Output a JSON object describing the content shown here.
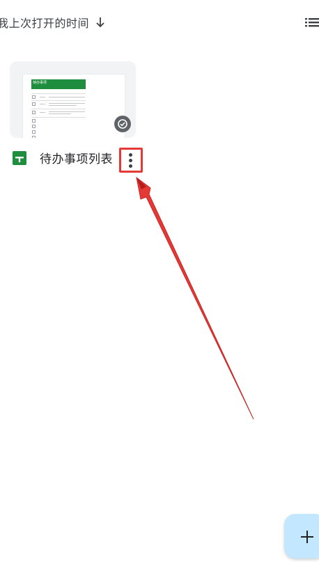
{
  "sort": {
    "label": "我上次打开的时间",
    "direction_icon": "arrow-down-icon"
  },
  "view_toggle_icon": "list-view-icon",
  "file": {
    "name": "待办事项列表",
    "type_icon": "sheets-icon",
    "thumbnail_title": "待办事项",
    "badge_icon": "offline-available-icon",
    "menu_icon": "more-vert-icon"
  },
  "fab": {
    "icon": "plus-icon"
  },
  "colors": {
    "accent_red": "#e53935",
    "sheets_green": "#1e8e3e",
    "fab_bg": "#c2e7ff"
  }
}
